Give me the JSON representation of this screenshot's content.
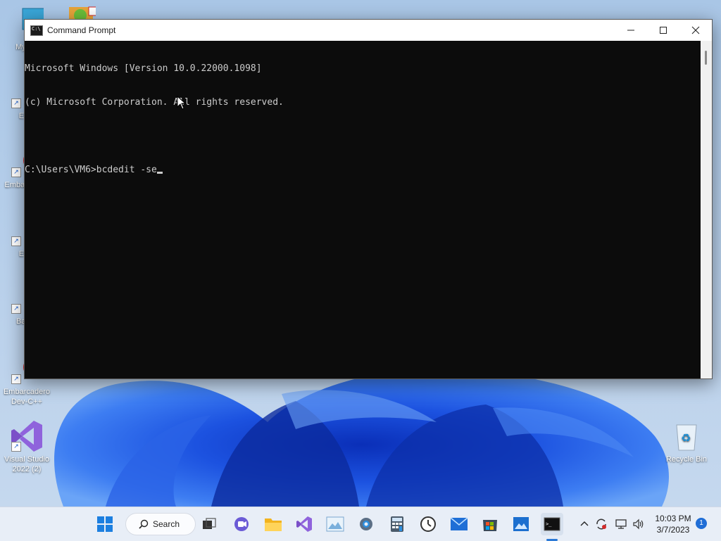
{
  "desktop": {
    "icons": [
      {
        "label": "My Co",
        "icon": "computer-icon"
      },
      {
        "label": "Ever",
        "icon": "everything-icon"
      },
      {
        "label": "Emba Dev-C",
        "icon": "devcpp-icon"
      },
      {
        "label": "Ever",
        "icon": "everything-icon"
      },
      {
        "label": "Bad P",
        "icon": "bad-piggies-icon"
      },
      {
        "label": "Embarcadero Dev-C++",
        "icon": "devcpp-icon"
      },
      {
        "label": "Visual Studio 2022 (2)",
        "icon": "visual-studio-icon"
      },
      {
        "label": "Recycle Bin",
        "icon": "recycle-bin-icon"
      }
    ]
  },
  "window": {
    "title": "Command Prompt",
    "controls": {
      "minimize": "minimize-icon",
      "maximize": "maximize-icon",
      "close": "close-icon"
    }
  },
  "console": {
    "lines": [
      "Microsoft Windows [Version 10.0.22000.1098]",
      "(c) Microsoft Corporation. All rights reserved.",
      "",
      "C:\\Users\\VM6>bcdedit -se"
    ],
    "text_color": "#cccccc",
    "background": "#0c0c0c"
  },
  "taskbar": {
    "search_label": "Search",
    "items": [
      "start-icon",
      "search-icon",
      "task-view-icon",
      "teams-chat-icon",
      "file-explorer-icon",
      "visual-studio-icon",
      "photos-icon",
      "settings-icon",
      "calculator-icon",
      "clock-app-icon",
      "mail-icon",
      "store-icon",
      "image-viewer-icon",
      "command-prompt-icon"
    ],
    "accent": "#2b79d6"
  },
  "tray": {
    "icons": [
      "chevron-up-icon",
      "sync-icon",
      "network-icon",
      "volume-icon"
    ],
    "time": "10:03 PM",
    "date": "3/7/2023",
    "notification_count": "1"
  }
}
